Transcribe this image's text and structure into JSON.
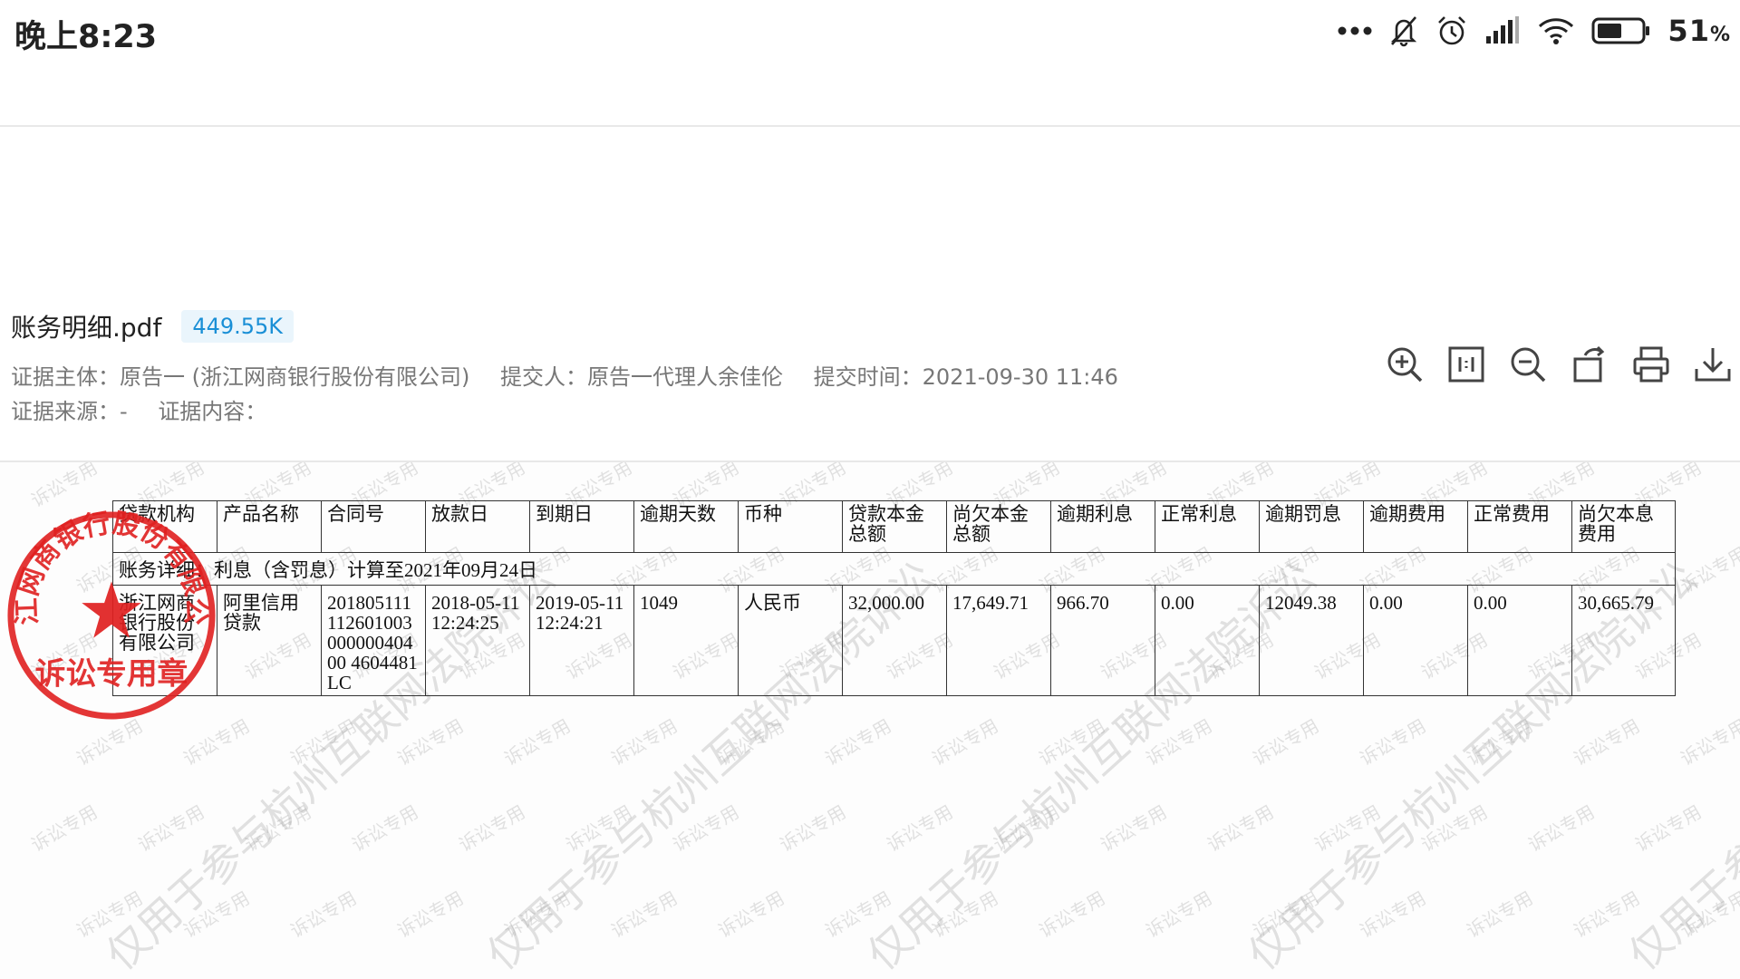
{
  "status_bar": {
    "time": "晚上8:23",
    "battery_percent": "51",
    "battery_suffix": "%",
    "icons": [
      "more-dots-icon",
      "mute-bell-icon",
      "alarm-icon",
      "signal-icon",
      "wifi-icon",
      "battery-icon"
    ]
  },
  "file": {
    "name": "账务明细.pdf",
    "size": "449.55K"
  },
  "meta": {
    "subject": "证据主体：原告一 (浙江网商银行股份有限公司)",
    "submitter": "提交人：原告一代理人余佳伦",
    "submit_time": "提交时间：2021-09-30 11:46",
    "source": "证据来源：-",
    "content": "证据内容："
  },
  "toolbar": {
    "icons": [
      "zoom-in-icon",
      "fit-page-icon",
      "zoom-out-icon",
      "rotate-icon",
      "print-icon",
      "download-icon"
    ]
  },
  "document": {
    "caption": "账务详细：利息（含罚息）计算至2021年09月24日",
    "headers": [
      "贷款机构",
      "产品名称",
      "合同号",
      "放款日",
      "到期日",
      "逾期天数",
      "币种",
      "贷款本金总额",
      "尚欠本金总额",
      "逾期利息",
      "正常利息",
      "逾期罚息",
      "逾期费用",
      "正常费用",
      "尚欠本息费用"
    ],
    "row": [
      "浙江网商银行股份有限公司",
      "阿里信用贷款",
      "20180511111260100300000040400 4604481LC",
      "2018-05-11 12:24:25",
      "2019-05-11 12:24:21",
      "1049",
      "人民币",
      "32,000.00",
      "17,649.71",
      "966.70",
      "0.00",
      "12049.38",
      "0.00",
      "0.00",
      "30,665.79"
    ],
    "seal": {
      "org_text": "浙江网商银行股份有限公司",
      "bottom_text": "诉讼专用章",
      "color": "#e02020"
    },
    "watermark_small": "诉讼专用",
    "watermark_big": "仅用于参与杭州互联网法院诉讼"
  }
}
